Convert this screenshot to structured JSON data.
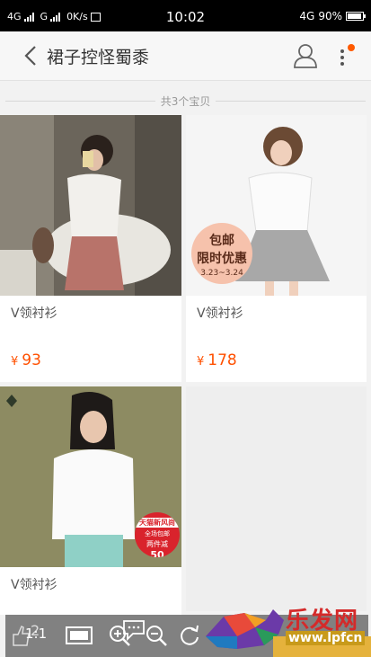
{
  "status_bar": {
    "network_left": "4G",
    "network_mid": "G",
    "speed": "0K/s",
    "speed_icon": "香",
    "time": "10:02",
    "network_right": "4G",
    "battery": "90%"
  },
  "header": {
    "title": "裙子控怪蜀黍",
    "back_icon": "chevron-left-icon",
    "user_icon": "user-icon",
    "more_icon": "more-vertical-icon",
    "badge_color": "#ff5a00"
  },
  "result_count": "共3个宝贝",
  "products": [
    {
      "name": "V领衬衫",
      "currency": "¥",
      "price": "93"
    },
    {
      "name": "V领衬衫",
      "currency": "¥",
      "price": "178",
      "promo": {
        "line1": "包邮",
        "line2": "限时优惠",
        "line3": "3.23~3.24"
      }
    },
    {
      "name": "V领衬衫",
      "tmall": {
        "line1": "天猫新风尚",
        "line2": "全场包邮",
        "line3": "两件减",
        "line4": "50"
      }
    }
  ],
  "toolbar": {
    "zoom_label": "1:1",
    "partial_value": "2",
    "icons": [
      "like-icon",
      "fullscreen-icon",
      "zoom-in-icon",
      "comment-icon",
      "zoom-out-icon",
      "rotate-icon",
      "delete-icon"
    ]
  },
  "watermark": {
    "text": "乐发网",
    "url": "www.lpfcn"
  },
  "colors": {
    "price": "#ff5000",
    "accent": "#ff5a00"
  }
}
